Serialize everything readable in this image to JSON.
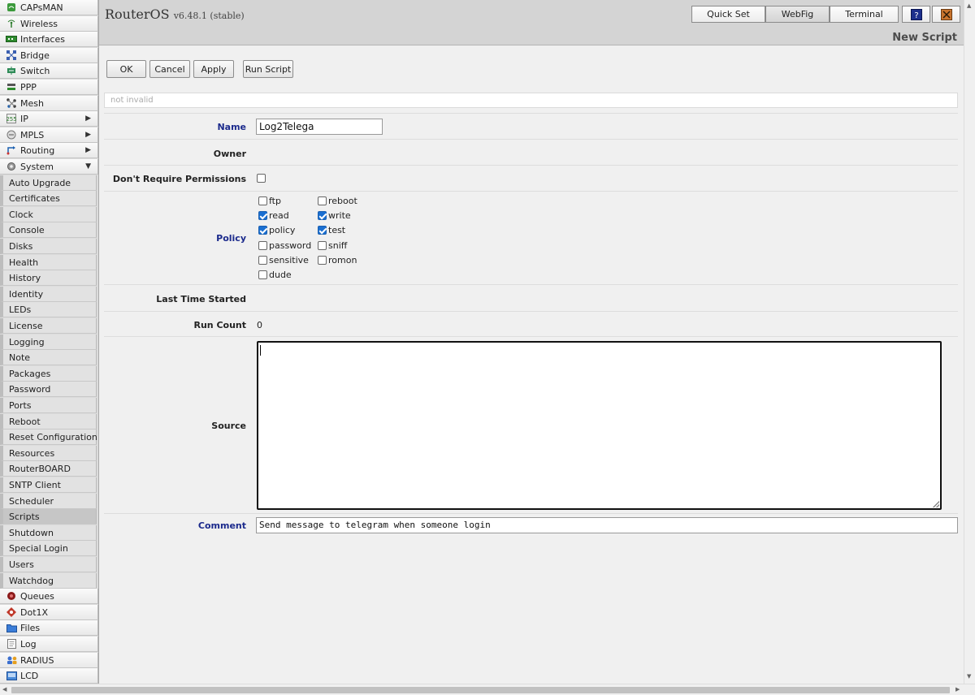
{
  "header": {
    "app_name": "RouterOS",
    "version": "v6.48.1 (stable)",
    "buttons": {
      "quick_set": "Quick Set",
      "webfig": "WebFig",
      "terminal": "Terminal"
    },
    "page_title": "New Script"
  },
  "sidebar": {
    "items": [
      {
        "label": "CAPsMAN",
        "icon": "capsman-icon"
      },
      {
        "label": "Wireless",
        "icon": "wireless-icon"
      },
      {
        "label": "Interfaces",
        "icon": "interfaces-icon"
      },
      {
        "label": "Bridge",
        "icon": "bridge-icon"
      },
      {
        "label": "Switch",
        "icon": "switch-icon"
      },
      {
        "label": "PPP",
        "icon": "ppp-icon"
      },
      {
        "label": "Mesh",
        "icon": "mesh-icon"
      },
      {
        "label": "IP",
        "icon": "ip-icon",
        "arrow": "▶"
      },
      {
        "label": "MPLS",
        "icon": "mpls-icon",
        "arrow": "▶"
      },
      {
        "label": "Routing",
        "icon": "routing-icon",
        "arrow": "▶"
      },
      {
        "label": "System",
        "icon": "system-icon",
        "arrow": "▼"
      }
    ],
    "system_subitems": [
      "Auto Upgrade",
      "Certificates",
      "Clock",
      "Console",
      "Disks",
      "Health",
      "History",
      "Identity",
      "LEDs",
      "License",
      "Logging",
      "Note",
      "Packages",
      "Password",
      "Ports",
      "Reboot",
      "Reset Configuration",
      "Resources",
      "RouterBOARD",
      "SNTP Client",
      "Scheduler",
      "Scripts",
      "Shutdown",
      "Special Login",
      "Users",
      "Watchdog"
    ],
    "active_subitem": "Scripts",
    "bottom_items": [
      {
        "label": "Queues",
        "icon": "queues-icon"
      },
      {
        "label": "Dot1X",
        "icon": "dot1x-icon"
      },
      {
        "label": "Files",
        "icon": "files-icon"
      },
      {
        "label": "Log",
        "icon": "log-icon"
      },
      {
        "label": "RADIUS",
        "icon": "radius-icon"
      },
      {
        "label": "LCD",
        "icon": "lcd-icon"
      }
    ]
  },
  "actions": {
    "ok": "OK",
    "cancel": "Cancel",
    "apply": "Apply",
    "run_script": "Run Script"
  },
  "status": "not invalid",
  "form": {
    "name_label": "Name",
    "name_value": "Log2Telega",
    "owner_label": "Owner",
    "permissions_label": "Don't Require Permissions",
    "permissions_checked": false,
    "policy_label": "Policy",
    "policies": [
      {
        "label": "ftp",
        "checked": false
      },
      {
        "label": "reboot",
        "checked": false
      },
      {
        "label": "read",
        "checked": true
      },
      {
        "label": "write",
        "checked": true
      },
      {
        "label": "policy",
        "checked": true
      },
      {
        "label": "test",
        "checked": true
      },
      {
        "label": "password",
        "checked": false
      },
      {
        "label": "sniff",
        "checked": false
      },
      {
        "label": "sensitive",
        "checked": false
      },
      {
        "label": "romon",
        "checked": false
      },
      {
        "label": "dude",
        "checked": false
      }
    ],
    "last_started_label": "Last Time Started",
    "run_count_label": "Run Count",
    "run_count_value": "0",
    "source_label": "Source",
    "source_value": "",
    "comment_label": "Comment",
    "comment_value": "Send message to telegram when someone login"
  },
  "colors": {
    "label_blue": "#1b2a8c",
    "check_blue": "#1a6fd1"
  }
}
